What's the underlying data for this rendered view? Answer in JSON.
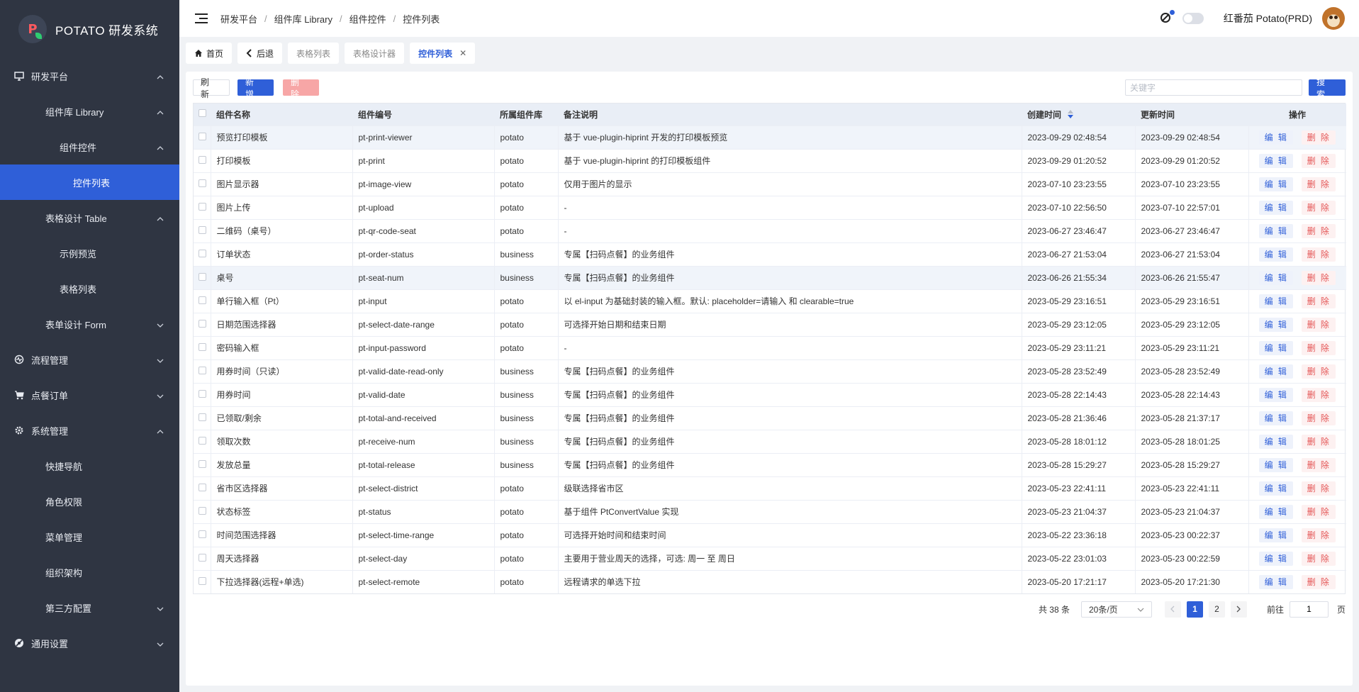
{
  "app": {
    "title": "POTATO 研发系统",
    "logo_letter": "P"
  },
  "sidebar": {
    "items": [
      {
        "label": "研发平台",
        "level": 1,
        "icon": "monitor-icon",
        "expanded": true
      },
      {
        "label": "组件库 Library",
        "level": 2,
        "expanded": true
      },
      {
        "label": "组件控件",
        "level": 3,
        "expanded": true
      },
      {
        "label": "控件列表",
        "level": 4,
        "active": true
      },
      {
        "label": "表格设计 Table",
        "level": 2,
        "expanded": true
      },
      {
        "label": "示例预览",
        "level": 3
      },
      {
        "label": "表格列表",
        "level": 3
      },
      {
        "label": "表单设计 Form",
        "level": 2,
        "expanded": false
      },
      {
        "label": "流程管理",
        "level": 1,
        "icon": "flow-icon",
        "expanded": false
      },
      {
        "label": "点餐订单",
        "level": 1,
        "icon": "cart-icon",
        "expanded": false
      },
      {
        "label": "系统管理",
        "level": 1,
        "icon": "gear-icon",
        "expanded": true
      },
      {
        "label": "快捷导航",
        "level": 2
      },
      {
        "label": "角色权限",
        "level": 2
      },
      {
        "label": "菜单管理",
        "level": 2
      },
      {
        "label": "组织架构",
        "level": 2
      },
      {
        "label": "第三方配置",
        "level": 2,
        "expanded": false
      },
      {
        "label": "通用设置",
        "level": 1,
        "icon": "settings-icon",
        "expanded": false
      }
    ]
  },
  "header": {
    "breadcrumb": [
      "研发平台",
      "组件库 Library",
      "组件控件",
      "控件列表"
    ],
    "username": "红番茄 Potato(PRD)"
  },
  "tabs": [
    {
      "label": "首页",
      "icon": "home-icon"
    },
    {
      "label": "后退",
      "icon": "back-icon"
    },
    {
      "label": "表格列表"
    },
    {
      "label": "表格设计器"
    },
    {
      "label": "控件列表",
      "current": true
    }
  ],
  "toolbar": {
    "refresh_label": "刷 新",
    "add_label": "新 增",
    "delete_label": "删 除",
    "search_placeholder": "关键字",
    "search_label": "搜 索"
  },
  "table": {
    "columns": [
      "组件名称",
      "组件编号",
      "所属组件库",
      "备注说明",
      "创建时间",
      "更新时间",
      "操作"
    ],
    "edit_label": "编 辑",
    "delete_label": "删 除",
    "rows": [
      {
        "name": "预览打印模板",
        "code": "pt-print-viewer",
        "lib": "potato",
        "note": "基于 vue-plugin-hiprint 开发的打印模板预览",
        "created": "2023-09-29 02:48:54",
        "updated": "2023-09-29 02:48:54"
      },
      {
        "name": "打印模板",
        "code": "pt-print",
        "lib": "potato",
        "note": "基于 vue-plugin-hiprint 的打印模板组件",
        "created": "2023-09-29 01:20:52",
        "updated": "2023-09-29 01:20:52"
      },
      {
        "name": "图片显示器",
        "code": "pt-image-view",
        "lib": "potato",
        "note": "仅用于图片的显示",
        "created": "2023-07-10 23:23:55",
        "updated": "2023-07-10 23:23:55"
      },
      {
        "name": "图片上传",
        "code": "pt-upload",
        "lib": "potato",
        "note": "-",
        "created": "2023-07-10 22:56:50",
        "updated": "2023-07-10 22:57:01"
      },
      {
        "name": "二维码（桌号）",
        "code": "pt-qr-code-seat",
        "lib": "potato",
        "note": "-",
        "created": "2023-06-27 23:46:47",
        "updated": "2023-06-27 23:46:47"
      },
      {
        "name": "订单状态",
        "code": "pt-order-status",
        "lib": "business",
        "note": "专属【扫码点餐】的业务组件",
        "created": "2023-06-27 21:53:04",
        "updated": "2023-06-27 21:53:04"
      },
      {
        "name": "桌号",
        "code": "pt-seat-num",
        "lib": "business",
        "note": "专属【扫码点餐】的业务组件",
        "created": "2023-06-26 21:55:34",
        "updated": "2023-06-26 21:55:47"
      },
      {
        "name": "单行输入框（Pt）",
        "code": "pt-input",
        "lib": "potato",
        "note": "以 el-input 为基础封装的输入框。默认: placeholder=请输入 和 clearable=true",
        "created": "2023-05-29 23:16:51",
        "updated": "2023-05-29 23:16:51"
      },
      {
        "name": "日期范围选择器",
        "code": "pt-select-date-range",
        "lib": "potato",
        "note": "可选择开始日期和结束日期",
        "created": "2023-05-29 23:12:05",
        "updated": "2023-05-29 23:12:05"
      },
      {
        "name": "密码输入框",
        "code": "pt-input-password",
        "lib": "potato",
        "note": "-",
        "created": "2023-05-29 23:11:21",
        "updated": "2023-05-29 23:11:21"
      },
      {
        "name": "用券时间（只读）",
        "code": "pt-valid-date-read-only",
        "lib": "business",
        "note": "专属【扫码点餐】的业务组件",
        "created": "2023-05-28 23:52:49",
        "updated": "2023-05-28 23:52:49"
      },
      {
        "name": "用券时间",
        "code": "pt-valid-date",
        "lib": "business",
        "note": "专属【扫码点餐】的业务组件",
        "created": "2023-05-28 22:14:43",
        "updated": "2023-05-28 22:14:43"
      },
      {
        "name": "已领取/剩余",
        "code": "pt-total-and-received",
        "lib": "business",
        "note": "专属【扫码点餐】的业务组件",
        "created": "2023-05-28 21:36:46",
        "updated": "2023-05-28 21:37:17"
      },
      {
        "name": "领取次数",
        "code": "pt-receive-num",
        "lib": "business",
        "note": "专属【扫码点餐】的业务组件",
        "created": "2023-05-28 18:01:12",
        "updated": "2023-05-28 18:01:25"
      },
      {
        "name": "发放总量",
        "code": "pt-total-release",
        "lib": "business",
        "note": "专属【扫码点餐】的业务组件",
        "created": "2023-05-28 15:29:27",
        "updated": "2023-05-28 15:29:27"
      },
      {
        "name": "省市区选择器",
        "code": "pt-select-district",
        "lib": "potato",
        "note": "级联选择省市区",
        "created": "2023-05-23 22:41:11",
        "updated": "2023-05-23 22:41:11"
      },
      {
        "name": "状态标签",
        "code": "pt-status",
        "lib": "potato",
        "note": "基于组件 PtConvertValue 实现",
        "created": "2023-05-23 21:04:37",
        "updated": "2023-05-23 21:04:37"
      },
      {
        "name": "时间范围选择器",
        "code": "pt-select-time-range",
        "lib": "potato",
        "note": "可选择开始时间和结束时间",
        "created": "2023-05-22 23:36:18",
        "updated": "2023-05-23 00:22:37"
      },
      {
        "name": "周天选择器",
        "code": "pt-select-day",
        "lib": "potato",
        "note": "主要用于营业周天的选择，可选: 周一 至 周日",
        "created": "2023-05-22 23:01:03",
        "updated": "2023-05-23 00:22:59"
      },
      {
        "name": "下拉选择器(远程+单选)",
        "code": "pt-select-remote",
        "lib": "potato",
        "note": "远程请求的单选下拉",
        "created": "2023-05-20 17:21:17",
        "updated": "2023-05-20 17:21:30"
      }
    ]
  },
  "pagination": {
    "total": "共 38 条",
    "page_size": "20条/页",
    "pages": [
      "1",
      "2"
    ],
    "current": "1",
    "goto_label": "前往",
    "goto_value": "1",
    "page_suffix": "页"
  },
  "colors": {
    "primary": "#2f5fd8",
    "sidebar_bg": "#2f3542",
    "danger": "#e45656",
    "danger_disabled": "#f7a6a6"
  }
}
